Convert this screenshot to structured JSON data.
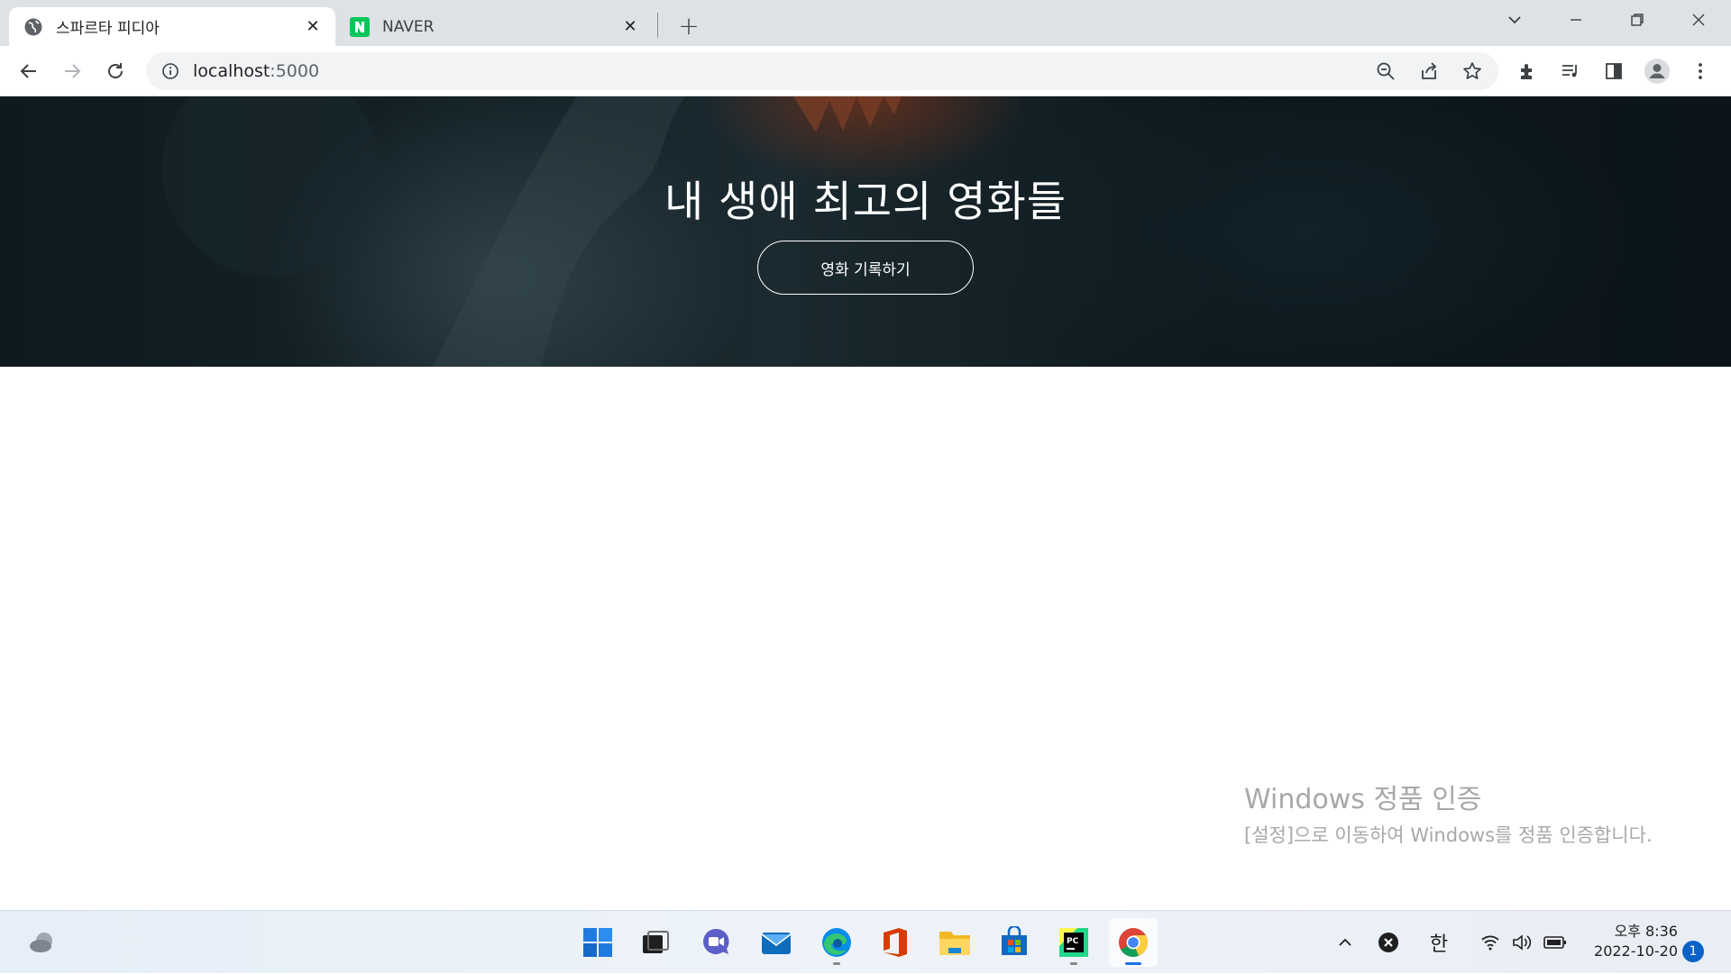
{
  "browser": {
    "tabs": [
      {
        "title": "스파르타 피디아",
        "active": true,
        "favicon": "globe-icon"
      },
      {
        "title": "NAVER",
        "active": false,
        "favicon": "naver-icon"
      }
    ],
    "url_host": "localhost",
    "url_port": ":5000",
    "colors": {
      "tabstrip": "#dee1e6",
      "omnibox": "#f1f3f4"
    }
  },
  "page": {
    "hero_title": "내 생애 최고의 영화들",
    "record_button": "영화 기록하기"
  },
  "watermark": {
    "title": "Windows 정품 인증",
    "subtitle": "[설정]으로 이동하여 Windows를 정품 인증합니다."
  },
  "taskbar": {
    "ime": "한",
    "clock_time": "오후 8:36",
    "clock_date": "2022-10-20",
    "notification_count": "1"
  }
}
